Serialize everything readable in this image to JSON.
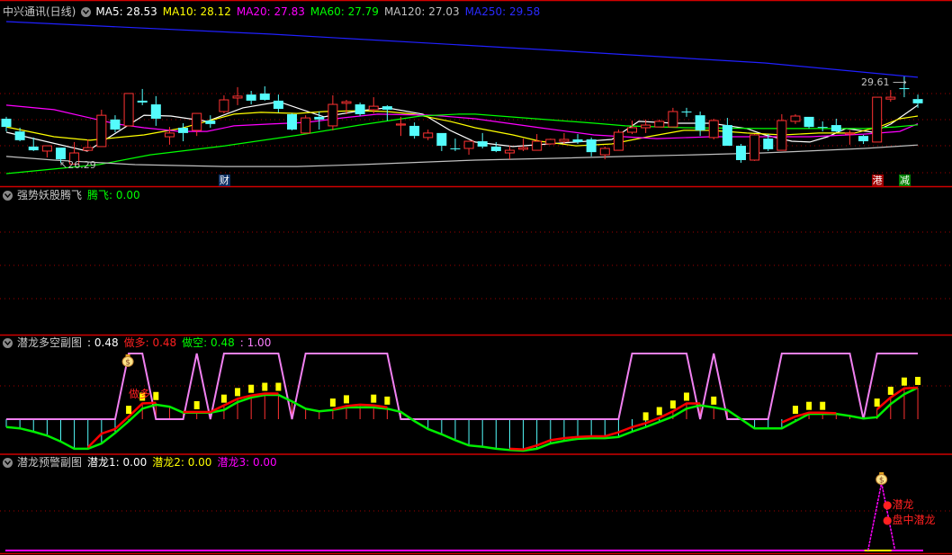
{
  "colors": {
    "background": "#000000",
    "separator": "#d00000",
    "grid": "#a00000",
    "up": "#ff3232",
    "down": "#54fcfc",
    "ma5": "#ffffff",
    "ma10": "#ffff00",
    "ma20": "#ff00ff",
    "ma60": "#00ff00",
    "ma120": "#c0c0c0",
    "ma250": "#2020ff",
    "signal": "#f080f0",
    "long_line": "#ff0000",
    "short_line": "#00ee00",
    "bar": "#ffff00"
  },
  "main": {
    "title": "中兴通讯(日线)",
    "ma_labels": [
      {
        "key": "ma5",
        "text": "MA5: 28.53"
      },
      {
        "key": "ma10",
        "text": "MA10: 28.12"
      },
      {
        "key": "ma20",
        "text": "MA20: 27.83"
      },
      {
        "key": "ma60",
        "text": "MA60: 27.79"
      },
      {
        "key": "ma120",
        "text": "MA120: 27.03"
      },
      {
        "key": "ma250",
        "text": "MA250: 29.58"
      }
    ],
    "low_marker": "26.29",
    "high_marker": "29.61",
    "tags": [
      {
        "text": "财",
        "color": "#0c2f63",
        "index": 16
      },
      {
        "text": "港",
        "color": "#a00000",
        "index": 64
      },
      {
        "text": "减",
        "color": "#008000",
        "index": 66
      }
    ]
  },
  "panel2": {
    "title": "强势妖股腾飞",
    "value_label": "腾飞: 0.00",
    "value": 0.0
  },
  "panel3": {
    "title": "潜龙多空副图",
    "value_main": ": 0.48",
    "long_label": "做多: 0.48",
    "short_label": "做空: 0.48",
    "signal_label": ": 1.00",
    "marker_text": "做多",
    "marker_index": 9
  },
  "panel4": {
    "title": "潜龙预警副图",
    "v1_label": "潜龙1: 0.00",
    "v2_label": "潜龙2: 0.00",
    "v3_label": "潜龙3: 0.00",
    "signal_index": 64,
    "legend": [
      "潜龙",
      "盘中潜龙"
    ]
  },
  "chart_data": {
    "type": "candlestick",
    "price_range": [
      25.9,
      31.8
    ],
    "candles_ohlc": [
      [
        28.02,
        28.09,
        27.54,
        27.71
      ],
      [
        27.54,
        27.68,
        27.17,
        27.21
      ],
      [
        26.97,
        27.31,
        26.8,
        26.83
      ],
      [
        26.8,
        27.0,
        26.56,
        27.0
      ],
      [
        26.93,
        26.93,
        26.36,
        26.49
      ],
      [
        26.31,
        27.14,
        26.29,
        26.73
      ],
      [
        26.83,
        27.24,
        26.8,
        26.93
      ],
      [
        26.97,
        28.36,
        26.97,
        28.15
      ],
      [
        27.99,
        28.15,
        27.51,
        27.61
      ],
      [
        27.75,
        28.97,
        27.75,
        28.97
      ],
      [
        28.7,
        29.14,
        28.53,
        28.63
      ],
      [
        28.56,
        28.87,
        27.75,
        28.02
      ],
      [
        27.34,
        27.71,
        27.04,
        27.48
      ],
      [
        27.68,
        27.85,
        27.17,
        27.48
      ],
      [
        27.58,
        28.22,
        27.37,
        28.22
      ],
      [
        27.95,
        28.15,
        27.68,
        27.82
      ],
      [
        28.29,
        28.9,
        28.22,
        28.73
      ],
      [
        28.8,
        29.21,
        28.53,
        28.87
      ],
      [
        28.93,
        29.07,
        28.56,
        28.7
      ],
      [
        28.97,
        29.24,
        28.7,
        28.73
      ],
      [
        28.7,
        28.93,
        28.26,
        28.39
      ],
      [
        28.19,
        28.22,
        27.58,
        27.61
      ],
      [
        27.48,
        28.15,
        27.48,
        28.05
      ],
      [
        28.09,
        28.29,
        27.61,
        27.99
      ],
      [
        27.75,
        28.9,
        27.58,
        28.56
      ],
      [
        28.6,
        28.73,
        28.19,
        28.66
      ],
      [
        28.56,
        28.63,
        28.12,
        28.19
      ],
      [
        28.36,
        28.83,
        28.22,
        28.49
      ],
      [
        28.49,
        28.53,
        27.95,
        28.36
      ],
      [
        27.78,
        28.09,
        27.37,
        27.82
      ],
      [
        27.75,
        27.88,
        27.27,
        27.37
      ],
      [
        27.31,
        27.61,
        27.21,
        27.48
      ],
      [
        27.48,
        27.48,
        26.8,
        27.0
      ],
      [
        26.9,
        27.27,
        26.8,
        26.87
      ],
      [
        26.9,
        27.17,
        26.66,
        27.17
      ],
      [
        27.17,
        27.48,
        26.9,
        26.97
      ],
      [
        26.97,
        27.14,
        26.76,
        26.8
      ],
      [
        26.73,
        27.0,
        26.49,
        26.83
      ],
      [
        26.87,
        27.27,
        26.8,
        26.93
      ],
      [
        26.83,
        27.44,
        26.83,
        27.17
      ],
      [
        27.07,
        27.27,
        27.04,
        27.24
      ],
      [
        27.17,
        27.48,
        27.07,
        27.24
      ],
      [
        27.24,
        27.44,
        27.07,
        27.14
      ],
      [
        27.24,
        27.31,
        26.6,
        26.76
      ],
      [
        26.66,
        26.97,
        26.49,
        26.9
      ],
      [
        26.83,
        27.61,
        26.83,
        27.51
      ],
      [
        27.51,
        27.95,
        27.44,
        27.68
      ],
      [
        27.68,
        27.99,
        27.48,
        27.78
      ],
      [
        27.71,
        27.99,
        27.71,
        27.92
      ],
      [
        27.71,
        28.43,
        27.71,
        28.29
      ],
      [
        28.29,
        28.43,
        28.09,
        28.26
      ],
      [
        28.15,
        28.29,
        27.37,
        27.58
      ],
      [
        27.31,
        28.02,
        27.24,
        27.95
      ],
      [
        27.78,
        28.05,
        27.0,
        27.0
      ],
      [
        27.0,
        27.07,
        26.36,
        26.46
      ],
      [
        26.46,
        27.44,
        26.43,
        27.41
      ],
      [
        27.27,
        27.44,
        26.8,
        26.87
      ],
      [
        26.83,
        28.19,
        26.83,
        27.95
      ],
      [
        27.92,
        28.19,
        27.82,
        28.12
      ],
      [
        28.09,
        28.09,
        27.65,
        27.71
      ],
      [
        27.71,
        27.92,
        27.54,
        27.68
      ],
      [
        27.78,
        28.02,
        27.51,
        27.54
      ],
      [
        27.44,
        27.58,
        27.04,
        27.48
      ],
      [
        27.37,
        27.41,
        27.07,
        27.17
      ],
      [
        27.14,
        28.83,
        27.14,
        28.83
      ],
      [
        28.76,
        29.1,
        28.66,
        28.83
      ],
      [
        29.17,
        29.61,
        28.83,
        29.14
      ],
      [
        28.76,
        28.93,
        28.43,
        28.6
      ]
    ],
    "moving_averages": {
      "ma5": [
        [
          0,
          27.51
        ],
        [
          5.95,
          26.8
        ],
        [
          10.12,
          28.15
        ],
        [
          12.1,
          28.12
        ],
        [
          14.75,
          27.92
        ],
        [
          17.39,
          28.43
        ],
        [
          20.04,
          28.66
        ],
        [
          22.35,
          28.26
        ],
        [
          23.35,
          28.09
        ],
        [
          25.99,
          28.32
        ],
        [
          27.98,
          28.43
        ],
        [
          30.62,
          28.19
        ],
        [
          32.61,
          27.58
        ],
        [
          34.46,
          27.14
        ],
        [
          37.24,
          26.97
        ],
        [
          39.88,
          27.07
        ],
        [
          44.51,
          27.24
        ],
        [
          46.49,
          27.92
        ],
        [
          49.14,
          27.85
        ],
        [
          51.79,
          27.85
        ],
        [
          54.43,
          27.65
        ],
        [
          55.75,
          27.41
        ],
        [
          57.74,
          27.17
        ],
        [
          59.06,
          27.14
        ],
        [
          60.38,
          27.34
        ],
        [
          61.71,
          27.65
        ],
        [
          63.69,
          27.51
        ],
        [
          65.01,
          27.82
        ],
        [
          67,
          28.53
        ]
      ],
      "ma10": [
        [
          0,
          27.71
        ],
        [
          3.51,
          27.34
        ],
        [
          6.15,
          27.21
        ],
        [
          8.13,
          27.31
        ],
        [
          10.12,
          27.41
        ],
        [
          12.76,
          27.65
        ],
        [
          14.75,
          27.92
        ],
        [
          16.73,
          28.19
        ],
        [
          18.72,
          28.26
        ],
        [
          21.36,
          28.22
        ],
        [
          23.35,
          28.29
        ],
        [
          25.99,
          28.32
        ],
        [
          27.98,
          28.29
        ],
        [
          29.96,
          28.19
        ],
        [
          32.61,
          27.92
        ],
        [
          34.46,
          27.68
        ],
        [
          37.24,
          27.41
        ],
        [
          39.22,
          27.17
        ],
        [
          41.87,
          27.0
        ],
        [
          44.51,
          27.07
        ],
        [
          47.16,
          27.34
        ],
        [
          49.8,
          27.58
        ],
        [
          51.79,
          27.58
        ],
        [
          54.43,
          27.48
        ],
        [
          57.08,
          27.41
        ],
        [
          59.72,
          27.48
        ],
        [
          62.37,
          27.48
        ],
        [
          64.35,
          27.75
        ],
        [
          65.67,
          28.02
        ],
        [
          67,
          28.12
        ]
      ],
      "ma20": [
        [
          0,
          28.53
        ],
        [
          3.51,
          28.36
        ],
        [
          6.15,
          28.05
        ],
        [
          8.13,
          27.82
        ],
        [
          10.12,
          27.68
        ],
        [
          12.76,
          27.54
        ],
        [
          14.75,
          27.54
        ],
        [
          16.73,
          27.75
        ],
        [
          19.38,
          27.82
        ],
        [
          22.02,
          27.88
        ],
        [
          24.67,
          28.05
        ],
        [
          27.31,
          28.19
        ],
        [
          31.28,
          28.15
        ],
        [
          34.46,
          28.02
        ],
        [
          39.22,
          27.68
        ],
        [
          43.19,
          27.41
        ],
        [
          47.82,
          27.27
        ],
        [
          51.79,
          27.34
        ],
        [
          59.06,
          27.34
        ],
        [
          63.03,
          27.44
        ],
        [
          65.67,
          27.54
        ],
        [
          67,
          27.83
        ]
      ],
      "ma60": [
        [
          0,
          25.95
        ],
        [
          6.81,
          26.29
        ],
        [
          10.58,
          26.66
        ],
        [
          16.07,
          27.0
        ],
        [
          21.56,
          27.41
        ],
        [
          25.99,
          27.78
        ],
        [
          30.42,
          28.12
        ],
        [
          33.27,
          28.19
        ],
        [
          34.46,
          28.19
        ],
        [
          38.89,
          28.02
        ],
        [
          43.25,
          27.85
        ],
        [
          45.5,
          27.75
        ],
        [
          49.9,
          27.68
        ],
        [
          55.62,
          27.65
        ],
        [
          63.1,
          27.65
        ],
        [
          65.34,
          27.71
        ],
        [
          67,
          27.79
        ]
      ],
      "ma120": [
        [
          0,
          26.6
        ],
        [
          3.51,
          26.46
        ],
        [
          9.46,
          26.29
        ],
        [
          16.07,
          26.22
        ],
        [
          21.36,
          26.22
        ],
        [
          25.99,
          26.29
        ],
        [
          34.46,
          26.46
        ],
        [
          40.61,
          26.53
        ],
        [
          45.5,
          26.6
        ],
        [
          50.53,
          26.66
        ],
        [
          55.62,
          26.73
        ],
        [
          58.73,
          26.8
        ],
        [
          63.1,
          26.9
        ],
        [
          67,
          27.03
        ]
      ],
      "ma250": [
        [
          0,
          31.68
        ],
        [
          19.38,
          31.21
        ],
        [
          39.22,
          30.63
        ],
        [
          55.75,
          30.12
        ],
        [
          67,
          29.58
        ]
      ]
    },
    "panel3_series": {
      "signal": [
        0,
        0,
        0,
        0,
        0,
        0,
        0,
        0,
        0,
        1,
        1,
        0,
        0,
        0,
        1,
        0,
        1,
        1,
        1,
        1,
        1,
        0,
        1,
        1,
        1,
        1,
        1,
        1,
        1,
        0,
        0,
        0,
        0,
        0,
        0,
        0,
        0,
        0,
        0,
        0,
        0,
        0,
        0,
        0,
        0,
        0,
        1,
        1,
        1,
        1,
        1,
        0,
        1,
        0,
        0,
        0,
        0,
        1,
        1,
        1,
        1,
        1,
        1,
        0,
        1,
        1,
        1,
        1
      ],
      "short": [
        -0.12,
        -0.14,
        -0.19,
        -0.25,
        -0.34,
        -0.45,
        -0.45,
        -0.37,
        -0.21,
        -0.03,
        0.16,
        0.22,
        0.19,
        0.1,
        0.1,
        0.1,
        0.14,
        0.26,
        0.33,
        0.37,
        0.37,
        0.27,
        0.16,
        0.12,
        0.14,
        0.18,
        0.18,
        0.18,
        0.16,
        0.11,
        -0.03,
        -0.15,
        -0.23,
        -0.32,
        -0.4,
        -0.42,
        -0.45,
        -0.47,
        -0.48,
        -0.45,
        -0.37,
        -0.33,
        -0.3,
        -0.29,
        -0.29,
        -0.27,
        -0.19,
        -0.12,
        -0.04,
        0.04,
        0.16,
        0.21,
        0.18,
        0.14,
        0.0,
        -0.14,
        -0.14,
        -0.14,
        -0.03,
        0.08,
        0.08,
        0.08,
        0.05,
        0.01,
        0.03,
        0.23,
        0.38,
        0.48
      ],
      "long": [
        null,
        null,
        null,
        null,
        null,
        null,
        -0.43,
        -0.22,
        -0.15,
        0.04,
        0.24,
        0.25,
        null,
        0.11,
        0.11,
        0.11,
        0.21,
        0.31,
        0.36,
        0.39,
        0.39,
        null,
        null,
        null,
        0.15,
        0.2,
        0.22,
        0.21,
        0.18,
        null,
        null,
        null,
        null,
        null,
        null,
        null,
        null,
        -0.45,
        -0.46,
        -0.4,
        -0.32,
        -0.29,
        -0.27,
        -0.26,
        -0.26,
        -0.2,
        -0.12,
        -0.06,
        0.02,
        0.12,
        0.24,
        0.24,
        null,
        null,
        null,
        null,
        null,
        -0.05,
        0.04,
        0.1,
        0.1,
        0.09,
        null,
        null,
        0.15,
        0.33,
        0.47,
        0.48
      ],
      "bar_indices": [
        9,
        10,
        11,
        14,
        16,
        17,
        18,
        19,
        20,
        24,
        25,
        27,
        28,
        47,
        48,
        49,
        50,
        52,
        58,
        59,
        60,
        64,
        65,
        66,
        67
      ]
    }
  }
}
